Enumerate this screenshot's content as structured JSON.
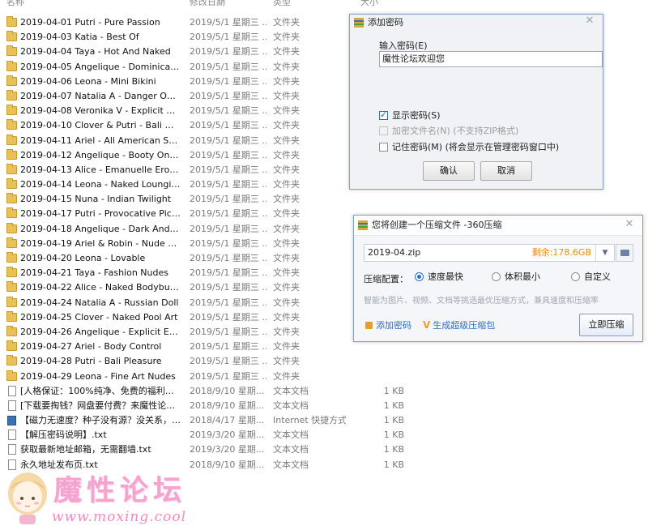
{
  "columns": {
    "name": "名称",
    "date": "修改日期",
    "type": "类型",
    "size": "大小"
  },
  "folders": [
    {
      "name": "2019-04-01 Putri - Pure Passion",
      "date": "2019/5/1 星期三 ...",
      "type": "文件夹"
    },
    {
      "name": "2019-04-03 Katia - Best Of",
      "date": "2019/5/1 星期三 ...",
      "type": "文件夹"
    },
    {
      "name": "2019-04-04 Taya - Hot And Naked",
      "date": "2019/5/1 星期三 ...",
      "type": "文件夹"
    },
    {
      "name": "2019-04-05 Angelique - Dominican It...",
      "date": "2019/5/1 星期三 ...",
      "type": "文件夹"
    },
    {
      "name": "2019-04-06 Leona - Mini Bikini",
      "date": "2019/5/1 星期三 ...",
      "type": "文件夹"
    },
    {
      "name": "2019-04-07 Natalia A - Danger On T...",
      "date": "2019/5/1 星期三 ...",
      "type": "文件夹"
    },
    {
      "name": "2019-04-08 Veronika V - Explicit Erot...",
      "date": "2019/5/1 星期三 ...",
      "type": "文件夹"
    },
    {
      "name": "2019-04-10 Clover & Putri - Bali Wat...",
      "date": "2019/5/1 星期三 ...",
      "type": "文件夹"
    },
    {
      "name": "2019-04-11 Ariel - All American Swee...",
      "date": "2019/5/1 星期三 ...",
      "type": "文件夹"
    },
    {
      "name": "2019-04-12 Angelique - Booty On Th...",
      "date": "2019/5/1 星期三 ...",
      "type": "文件夹"
    },
    {
      "name": "2019-04-13 Alice - Emanuelle Erotica",
      "date": "2019/5/1 星期三 ...",
      "type": "文件夹"
    },
    {
      "name": "2019-04-14 Leona - Naked Lounging",
      "date": "2019/5/1 星期三 ...",
      "type": "文件夹"
    },
    {
      "name": "2019-04-15 Nuna - Indian Twilight",
      "date": "2019/5/1 星期三 ...",
      "type": "文件夹"
    },
    {
      "name": "2019-04-17 Putri - Provocative Pictur...",
      "date": "2019/5/1 星期三 ...",
      "type": "文件夹"
    },
    {
      "name": "2019-04-18 Angelique - Dark And Di...",
      "date": "2019/5/1 星期三 ...",
      "type": "文件夹"
    },
    {
      "name": "2019-04-19 Ariel & Robin - Nude Ath...",
      "date": "2019/5/1 星期三 ...",
      "type": "文件夹"
    },
    {
      "name": "2019-04-20 Leona - Lovable",
      "date": "2019/5/1 星期三 ...",
      "type": "文件夹"
    },
    {
      "name": "2019-04-21 Taya - Fashion Nudes",
      "date": "2019/5/1 星期三 ...",
      "type": "文件夹"
    },
    {
      "name": "2019-04-22 Alice - Naked Bodybuildi...",
      "date": "2019/5/1 星期三 ...",
      "type": "文件夹"
    },
    {
      "name": "2019-04-24 Natalia A - Russian Doll",
      "date": "2019/5/1 星期三 ...",
      "type": "文件夹"
    },
    {
      "name": "2019-04-25 Clover - Naked Pool Art",
      "date": "2019/5/1 星期三 ...",
      "type": "文件夹"
    },
    {
      "name": "2019-04-26 Angelique - Explicit Erotica",
      "date": "2019/5/1 星期三 ...",
      "type": "文件夹"
    },
    {
      "name": "2019-04-27 Ariel - Body Control",
      "date": "2019/5/1 星期三 ...",
      "type": "文件夹"
    },
    {
      "name": "2019-04-28 Putri - Bali Pleasure",
      "date": "2019/5/1 星期三 ...",
      "type": "文件夹"
    },
    {
      "name": "2019-04-29 Leona - Fine Art Nudes",
      "date": "2019/5/1 星期三 ...",
      "type": "文件夹"
    }
  ],
  "files": [
    {
      "icon": "txt",
      "name": "[人格保证：100%纯净、免费的福利网站...",
      "date": "2018/9/10 星期...",
      "type": "文本文档",
      "size": "1 KB"
    },
    {
      "icon": "txt",
      "name": "[下载要掏钱？网盘要付费？来魔性论坛...",
      "date": "2018/9/10 星期...",
      "type": "文本文档",
      "size": "1 KB"
    },
    {
      "icon": "url",
      "name": "【磁力无速度？种子没有源？没关系，来...",
      "date": "2018/4/17 星期...",
      "type": "Internet 快捷方式",
      "size": "1 KB"
    },
    {
      "icon": "txt",
      "name": "【解压密码说明】.txt",
      "date": "2019/3/20 星期...",
      "type": "文本文档",
      "size": "1 KB"
    },
    {
      "icon": "txt",
      "name": "获取最新地址邮箱，无需翻墙.txt",
      "date": "2019/3/20 星期...",
      "type": "文本文档",
      "size": "1 KB"
    },
    {
      "icon": "txt",
      "name": "永久地址发布页.txt",
      "date": "2018/9/10 星期...",
      "type": "文本文档",
      "size": "1 KB"
    }
  ],
  "password_dialog": {
    "title": "添加密码",
    "close": "✕",
    "input_label": "输入密码(E)",
    "password_value": "魔性论坛欢迎您",
    "show_password": "显示密码(S)",
    "encrypt_names": "加密文件名(N) (不支持ZIP格式)",
    "remember": "记住密码(M) (将会显示在管理密码窗口中)",
    "ok": "确认",
    "cancel": "取消"
  },
  "zip_dialog": {
    "title": "您将创建一个压缩文件 -360压缩",
    "close": "✕",
    "filename": "2019-04.zip",
    "free_space": "剩余:178.6GB",
    "config_label": "压缩配置：",
    "options": [
      "速度最快",
      "体积最小",
      "自定义"
    ],
    "selected": "速度最快",
    "hint": "智能为图片、视频、文档等挑选最优压缩方式，兼具速度和压缩率",
    "add_password": "添加密码",
    "super_zip": "生成超级压缩包",
    "compress_now": "立即压缩"
  },
  "watermark": {
    "title": "魔性论坛",
    "url": "www.moxing.cool"
  }
}
